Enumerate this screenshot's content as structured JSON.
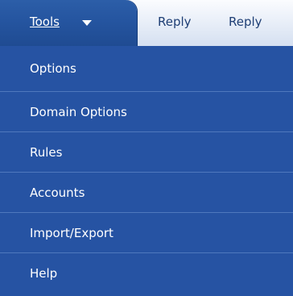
{
  "toolbar": {
    "tools_label": "Tools",
    "reply_label": "Reply",
    "reply2_label": "Reply"
  },
  "menu": {
    "items": [
      {
        "label": "Options"
      },
      {
        "label": "Domain Options"
      },
      {
        "label": "Rules"
      },
      {
        "label": "Accounts"
      },
      {
        "label": "Import/Export"
      },
      {
        "label": "Help"
      }
    ]
  },
  "colors": {
    "menu_bg": "#2653a3",
    "tab_bg": "#2555a0",
    "toolbar_bg": "#e8eef8",
    "menu_text": "#ffffff",
    "toolbar_text": "#1f3f75"
  },
  "icons": {
    "dropdown_caret": "caret-down-icon"
  }
}
